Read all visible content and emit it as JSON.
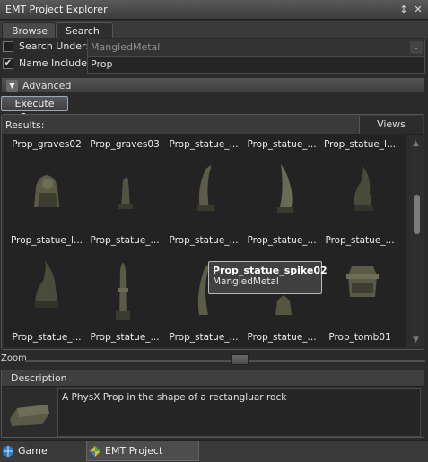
{
  "window": {
    "title": "EMT Project Explorer",
    "pin_icon": "pin-icon",
    "close_icon": "close-icon"
  },
  "tabs": [
    "Browse",
    "Search"
  ],
  "search_under": {
    "label": "Search Under:",
    "value": "MangledMetal",
    "checked": false
  },
  "name_includes": {
    "label": "Name Includes:",
    "value": "Prop",
    "checked": true
  },
  "advanced": {
    "label": "Advanced"
  },
  "execute_query": {
    "label": "Execute Query"
  },
  "results": {
    "label": "Results:",
    "views_label": "Views",
    "items": [
      "Prop_graves02",
      "Prop_graves03",
      "Prop_statue_...",
      "Prop_statue_...",
      "Prop_statue_l...",
      "Prop_statue_l...",
      "Prop_statue_...",
      "Prop_statue_...",
      "Prop_statue_...",
      "Prop_statue_...",
      "Prop_statue_...",
      "Prop_statue_...",
      "Prop_statue_...",
      "Prop_statue_...",
      "Prop_tomb01"
    ]
  },
  "tooltip": {
    "name": "Prop_statue_spike02",
    "location": "MangledMetal"
  },
  "zoom": {
    "label": "Zoom",
    "level": 0.52
  },
  "description": {
    "label": "Description",
    "text": "A PhysX Prop in the shape of a rectangluar rock"
  },
  "bottom_tabs": [
    "Game Solution",
    "EMT Project Explorer"
  ]
}
